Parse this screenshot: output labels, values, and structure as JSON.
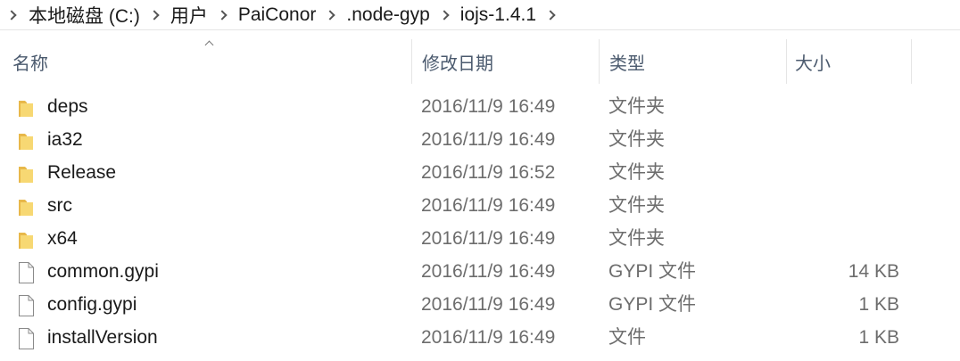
{
  "breadcrumb": {
    "items": [
      {
        "label": "本地磁盘 (C:)"
      },
      {
        "label": "用户"
      },
      {
        "label": "PaiConor"
      },
      {
        "label": ".node-gyp"
      },
      {
        "label": "iojs-1.4.1"
      }
    ]
  },
  "columns": {
    "name": "名称",
    "date": "修改日期",
    "type": "类型",
    "size": "大小"
  },
  "sort": {
    "column": "name",
    "direction": "ascending"
  },
  "files": [
    {
      "name": "deps",
      "date": "2016/11/9 16:49",
      "type": "文件夹",
      "size": "",
      "icon": "folder-icon"
    },
    {
      "name": "ia32",
      "date": "2016/11/9 16:49",
      "type": "文件夹",
      "size": "",
      "icon": "folder-icon"
    },
    {
      "name": "Release",
      "date": "2016/11/9 16:52",
      "type": "文件夹",
      "size": "",
      "icon": "folder-icon"
    },
    {
      "name": "src",
      "date": "2016/11/9 16:49",
      "type": "文件夹",
      "size": "",
      "icon": "folder-icon"
    },
    {
      "name": "x64",
      "date": "2016/11/9 16:49",
      "type": "文件夹",
      "size": "",
      "icon": "folder-icon"
    },
    {
      "name": "common.gypi",
      "date": "2016/11/9 16:49",
      "type": "GYPI 文件",
      "size": "14 KB",
      "icon": "file-icon"
    },
    {
      "name": "config.gypi",
      "date": "2016/11/9 16:49",
      "type": "GYPI 文件",
      "size": "1 KB",
      "icon": "file-icon"
    },
    {
      "name": "installVersion",
      "date": "2016/11/9 16:49",
      "type": "文件",
      "size": "1 KB",
      "icon": "file-icon"
    }
  ],
  "colors": {
    "folder": "#e8b84a",
    "folder_light": "#f7d873",
    "header_text": "#4b5a6e",
    "secondary_text": "#6d6d6d"
  }
}
